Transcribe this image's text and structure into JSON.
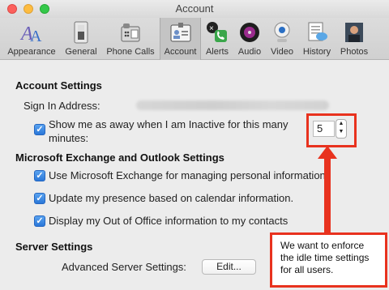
{
  "window": {
    "title": "Account"
  },
  "toolbar": {
    "items": [
      {
        "label": "Appearance",
        "icon": "appearance-icon"
      },
      {
        "label": "General",
        "icon": "general-switch-icon"
      },
      {
        "label": "Phone Calls",
        "icon": "phone-icon"
      },
      {
        "label": "Account",
        "icon": "account-card-icon",
        "active": true
      },
      {
        "label": "Alerts",
        "icon": "alerts-icon"
      },
      {
        "label": "Audio",
        "icon": "audio-icon"
      },
      {
        "label": "Video",
        "icon": "webcam-icon"
      },
      {
        "label": "History",
        "icon": "history-icon"
      },
      {
        "label": "Photos",
        "icon": "photos-icon"
      }
    ]
  },
  "account_settings": {
    "heading": "Account Settings",
    "sign_in_label": "Sign In Address:",
    "away_label_line1": "Show me as away when I am Inactive for this many",
    "away_label_line2": "minutes:",
    "away_minutes": "5"
  },
  "exchange_settings": {
    "heading": "Microsoft Exchange and Outlook Settings",
    "options": [
      "Use Microsoft Exchange for managing personal information",
      "Update my presence based on calendar information.",
      "Display my Out of Office information to my contacts"
    ]
  },
  "server_settings": {
    "heading": "Server Settings",
    "advanced_label": "Advanced Server Settings:",
    "edit_button": "Edit..."
  },
  "annotation": {
    "text": "We want to enforce\nthe idle time settings\nfor all users.",
    "color": "#e8321e"
  }
}
